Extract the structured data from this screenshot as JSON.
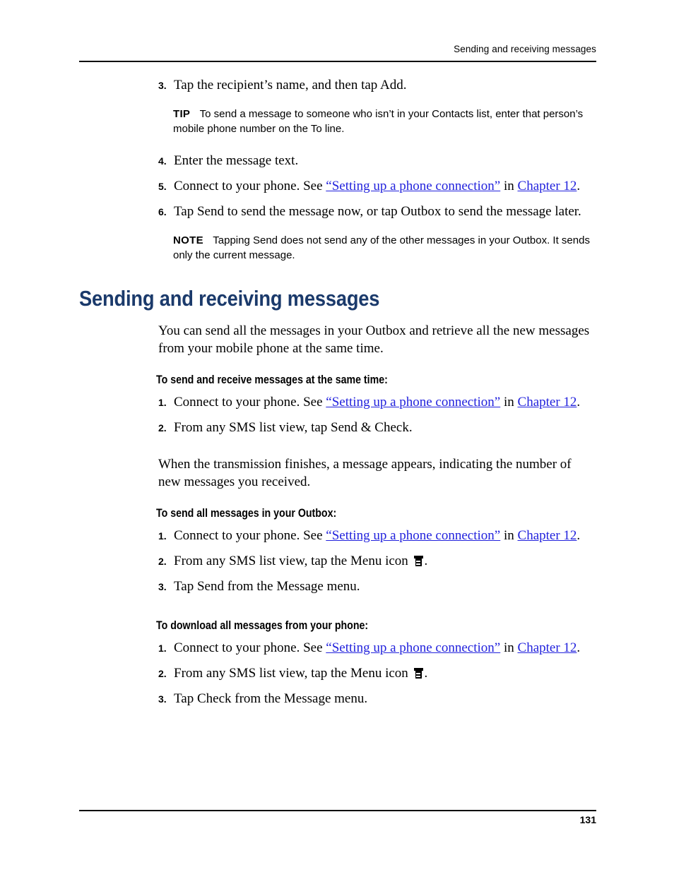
{
  "header": {
    "running_head": "Sending and receiving messages"
  },
  "footer": {
    "page_number": "131"
  },
  "colors": {
    "heading": "#1b3a6b",
    "link": "#2222dd",
    "text": "#000000"
  },
  "steps_top": [
    {
      "num": "3",
      "text": "Tap the recipient’s name, and then tap Add."
    }
  ],
  "tip": {
    "tag": "TIP",
    "text": "To send a message to someone who isn’t in your Contacts list, enter that person’s mobile phone number on the To line."
  },
  "steps_top2": [
    {
      "num": "4",
      "text": "Enter the message text."
    },
    {
      "num": "6",
      "text": "Tap Send to send the message now, or tap Outbox to send the message later."
    }
  ],
  "step5": {
    "num": "5",
    "prefix": "Connect to your phone. See ",
    "link1": "“Setting up a phone connection”",
    "middle": " in ",
    "link2": "Chapter 12",
    "suffix": "."
  },
  "note": {
    "tag": "NOTE",
    "text": "Tapping Send does not send any of the other messages in your Outbox. It sends only the current message."
  },
  "section": {
    "heading": "Sending and receiving messages",
    "intro": "You can send all the messages in your Outbox and retrieve all the new messages from your mobile phone at the same time."
  },
  "proc1": {
    "heading": "To send and receive messages at the same time:",
    "step1": {
      "num": "1",
      "prefix": "Connect to your phone. See ",
      "link1": "“Setting up a phone connection”",
      "middle": " in ",
      "link2": "Chapter 12",
      "suffix": "."
    },
    "step2": {
      "num": "2",
      "text": "From any SMS list view, tap Send & Check."
    },
    "after": "When the transmission finishes, a message appears, indicating the number of new messages you received."
  },
  "proc2": {
    "heading": "To send all messages in your Outbox:",
    "step1": {
      "num": "1",
      "prefix": "Connect to your phone. See ",
      "link1": "“Setting up a phone connection”",
      "middle": " in ",
      "link2": "Chapter 12",
      "suffix": "."
    },
    "step2": {
      "num": "2",
      "prefix": "From any SMS list view, tap the Menu icon ",
      "icon": "menu-icon",
      "suffix": "."
    },
    "step3": {
      "num": "3",
      "text": "Tap Send from the Message menu."
    }
  },
  "proc3": {
    "heading": "To download all messages from your phone:",
    "step1": {
      "num": "1",
      "prefix": "Connect to your phone. See ",
      "link1": "“Setting up a phone connection”",
      "middle": " in ",
      "link2": "Chapter 12",
      "suffix": "."
    },
    "step2": {
      "num": "2",
      "prefix": "From any SMS list view, tap the Menu icon ",
      "icon": "menu-icon",
      "suffix": "."
    },
    "step3": {
      "num": "3",
      "text": "Tap Check from the Message menu."
    }
  }
}
